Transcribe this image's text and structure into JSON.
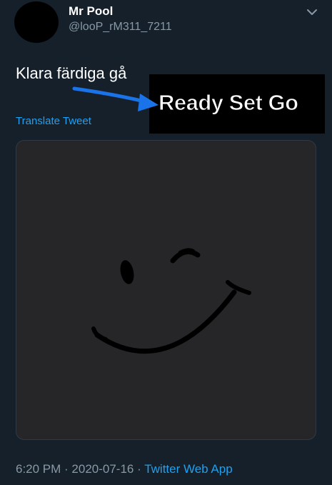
{
  "header": {
    "display_name": "Mr Pool",
    "handle": "@looP_rM311_7211",
    "menu_icon": "chevron-down-icon"
  },
  "tweet": {
    "text": "Klara färdiga gå",
    "translate_label": "Translate Tweet"
  },
  "annotation": {
    "text": "Ready Set Go",
    "arrow_color": "#1a73e8"
  },
  "media": {
    "icon": "winking-smiley-icon"
  },
  "footer": {
    "timestamp": "6:20 PM · 2020-07-16 · ",
    "source": "Twitter Web App"
  },
  "colors": {
    "background": "#15202b",
    "link": "#1da1f2",
    "secondary_text": "#8899a6"
  }
}
